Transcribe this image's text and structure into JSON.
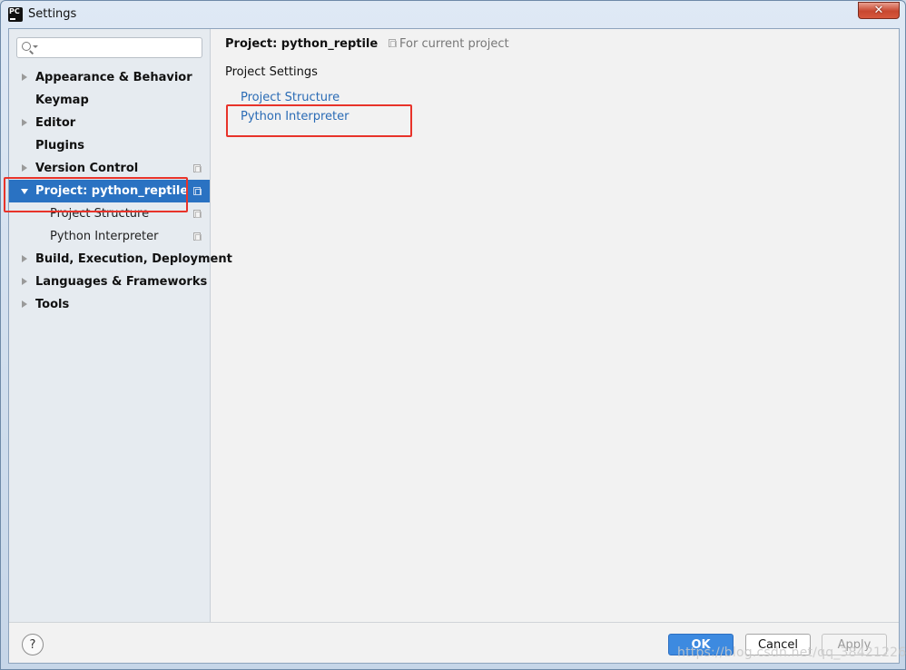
{
  "window": {
    "title": "Settings",
    "app_icon_text": "PC",
    "close_glyph": "✕"
  },
  "search": {
    "placeholder": ""
  },
  "tree": [
    {
      "label": "Appearance & Behavior",
      "expandable": true,
      "selected": false,
      "child": false,
      "copy": false
    },
    {
      "label": "Keymap",
      "expandable": false,
      "selected": false,
      "child": false,
      "copy": false
    },
    {
      "label": "Editor",
      "expandable": true,
      "selected": false,
      "child": false,
      "copy": false
    },
    {
      "label": "Plugins",
      "expandable": false,
      "selected": false,
      "child": false,
      "copy": false
    },
    {
      "label": "Version Control",
      "expandable": true,
      "selected": false,
      "child": false,
      "copy": true
    },
    {
      "label": "Project: python_reptile",
      "expandable": true,
      "expanded": true,
      "selected": true,
      "child": false,
      "copy": true
    },
    {
      "label": "Project Structure",
      "expandable": false,
      "selected": false,
      "child": true,
      "copy": true
    },
    {
      "label": "Python Interpreter",
      "expandable": false,
      "selected": false,
      "child": true,
      "copy": true
    },
    {
      "label": "Build, Execution, Deployment",
      "expandable": true,
      "selected": false,
      "child": false,
      "copy": false
    },
    {
      "label": "Languages & Frameworks",
      "expandable": true,
      "selected": false,
      "child": false,
      "copy": false
    },
    {
      "label": "Tools",
      "expandable": true,
      "selected": false,
      "child": false,
      "copy": false
    }
  ],
  "main": {
    "title": "Project: python_reptile",
    "scope_label": "For current project",
    "section_title": "Project Settings",
    "links": [
      "Project Structure",
      "Python Interpreter"
    ]
  },
  "footer": {
    "help_label": "?",
    "ok_label": "OK",
    "cancel_label": "Cancel",
    "apply_label": "Apply"
  },
  "watermark": "https://blog.csdn.net/qq_38421226",
  "colors": {
    "selection": "#2a72c2",
    "link": "#2a6bb5",
    "highlight": "#e8332a",
    "ok_button": "#3d8ae0"
  }
}
